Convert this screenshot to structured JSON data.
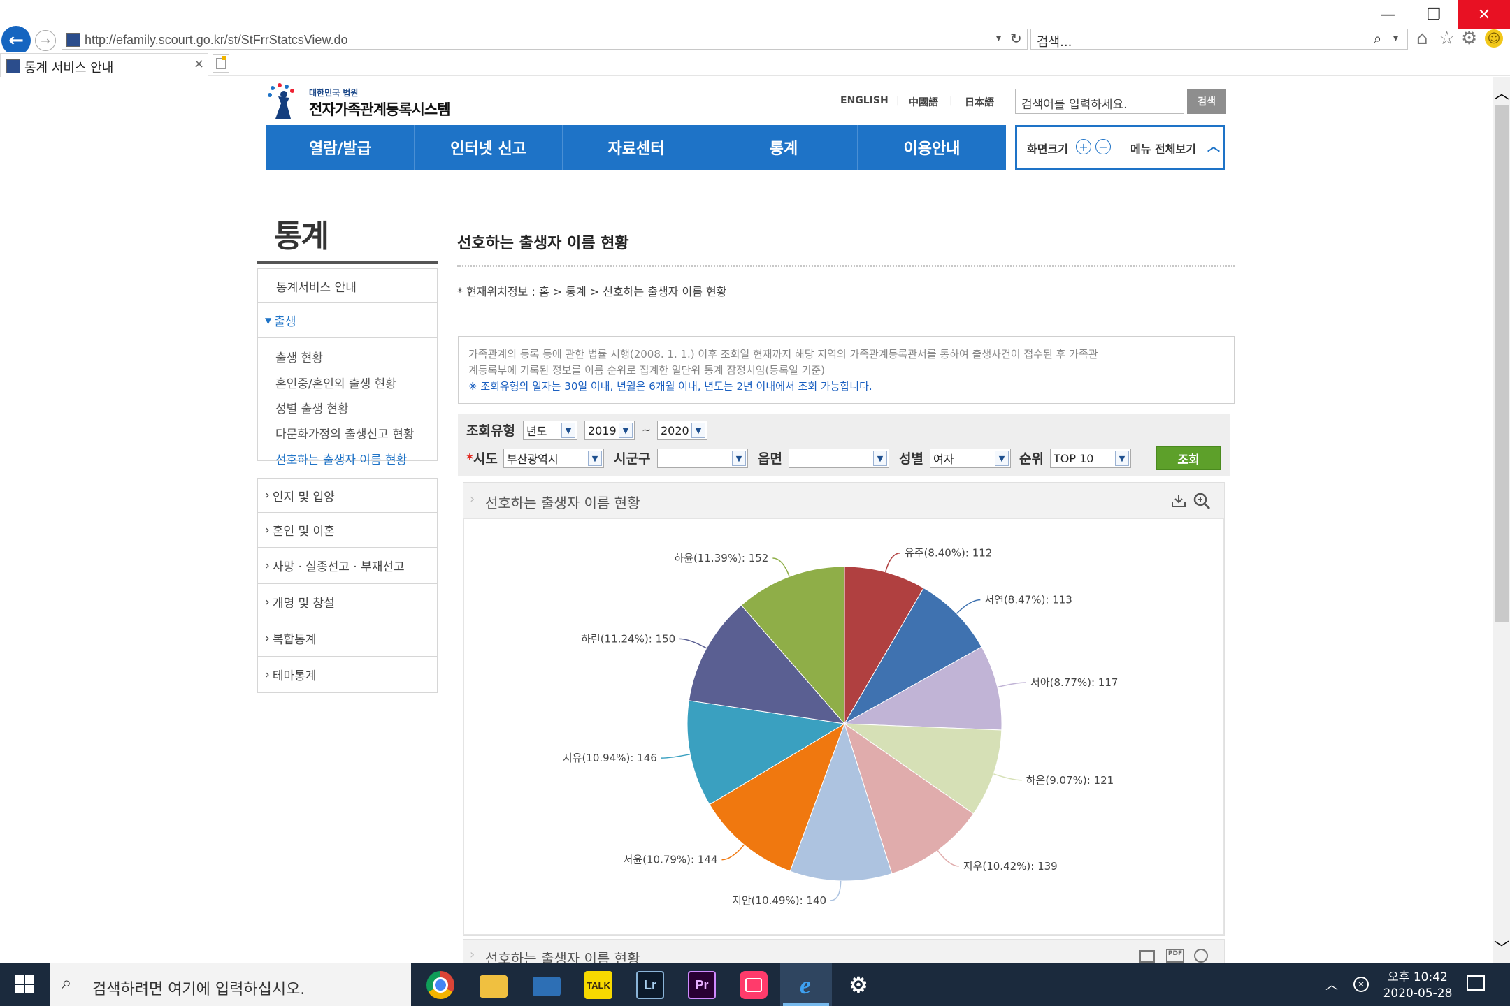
{
  "browser": {
    "url": "http://efamily.scourt.go.kr/st/StFrrStatcsView.do",
    "search_placeholder": "검색...",
    "tab_title": "통계 서비스 안내"
  },
  "site": {
    "logo_small": "대한민국 법원",
    "logo_title": "전자가족관계등록시스템",
    "lang_links": [
      "ENGLISH",
      "中國語",
      "日本語"
    ],
    "search_placeholder": "검색어를 입력하세요.",
    "search_button": "검색",
    "gnb": [
      "열람/발급",
      "인터넷 신고",
      "자료센터",
      "통계",
      "이용안내"
    ],
    "screen_size_label": "화면크기",
    "menu_all_label": "메뉴 전체보기"
  },
  "sidebar": {
    "title": "통계",
    "items": [
      {
        "label": "통계서비스 안내"
      },
      {
        "label": "출생"
      },
      {
        "label": "인지 및 입양"
      },
      {
        "label": "혼인 및 이혼"
      },
      {
        "label": "사망 · 실종선고 · 부재선고"
      },
      {
        "label": "개명 및 창설"
      },
      {
        "label": "복합통계"
      },
      {
        "label": "테마통계"
      }
    ],
    "sub_items": [
      "출생 현황",
      "혼인중/혼인외 출생 현황",
      "성별 출생 현황",
      "다문화가정의 출생신고 현황",
      "선호하는 출생자 이름 현황"
    ]
  },
  "content": {
    "title": "선호하는 출생자 이름 현황",
    "location": "* 현재위치정보 : 홈 > 통계 > 선호하는 출생자 이름 현황",
    "notice_line1": "가족관계의 등록 등에 관한 법률 시행(2008. 1. 1.) 이후 조회일 현재까지 해당 지역의 가족관계등록관서를 통하여 출생사건이 접수된 후 가족관",
    "notice_line2": "계등록부에 기록된 정보를 이름 순위로 집계한 일단위 통계 잠정치임(등록일 기준)",
    "notice_highlight": "※ 조회유형의 일자는 30일 이내, 년월은 6개월 이내, 년도는 2년 이내에서 조회 가능합니다.",
    "filters": {
      "type_label": "조회유형",
      "type_value": "년도",
      "from_year": "2019",
      "tilde": "~",
      "to_year": "2020",
      "sido_label": "시도",
      "sido_value": "부산광역시",
      "sigungu_label": "시군구",
      "sigungu_value": "",
      "eup_label": "읍면",
      "eup_value": "",
      "gender_label": "성별",
      "gender_value": "여자",
      "rank_label": "순위",
      "rank_value": "TOP 10",
      "search_button": "조회"
    },
    "panel_title": "선호하는 출생자 이름 현황",
    "panel2_title": "선호하는 출생자 이름 현황"
  },
  "chart_data": {
    "type": "pie",
    "slices": [
      {
        "label": "유주(8.40%): 112",
        "name": "유주",
        "value": 112,
        "percent": 8.4,
        "color": "#b04040"
      },
      {
        "label": "서연(8.47%): 113",
        "name": "서연",
        "value": 113,
        "percent": 8.47,
        "color": "#3f72b0"
      },
      {
        "label": "서아(8.77%): 117",
        "name": "서아",
        "value": 117,
        "percent": 8.77,
        "color": "#c1b4d6"
      },
      {
        "label": "하은(9.07%): 121",
        "name": "하은",
        "value": 121,
        "percent": 9.07,
        "color": "#d6e0b6"
      },
      {
        "label": "지우(10.42%): 139",
        "name": "지우",
        "value": 139,
        "percent": 10.42,
        "color": "#e0acac"
      },
      {
        "label": "지안(10.49%): 140",
        "name": "지안",
        "value": 140,
        "percent": 10.49,
        "color": "#adc3e0"
      },
      {
        "label": "서윤(10.79%): 144",
        "name": "서윤",
        "value": 144,
        "percent": 10.79,
        "color": "#f0780f"
      },
      {
        "label": "지유(10.94%): 146",
        "name": "지유",
        "value": 146,
        "percent": 10.94,
        "color": "#3aa0c0"
      },
      {
        "label": "하린(11.24%): 150",
        "name": "하린",
        "value": 150,
        "percent": 11.24,
        "color": "#5a5f92"
      },
      {
        "label": "하윤(11.39%): 152",
        "name": "하윤",
        "value": 152,
        "percent": 11.39,
        "color": "#8fae48"
      }
    ]
  },
  "taskbar": {
    "search_placeholder": "검색하려면 여기에 입력하십시오.",
    "time": "오후 10:42",
    "date": "2020-05-28",
    "apps": [
      "chrome-icon",
      "file-explorer-icon",
      "device-icon",
      "kakaotalk-icon",
      "lightroom-icon",
      "premiere-icon",
      "app-icon",
      "ie-icon",
      "settings-icon"
    ],
    "kakao_label": "TALK",
    "lightroom_label": "Lr",
    "premiere_label": "Pr"
  }
}
